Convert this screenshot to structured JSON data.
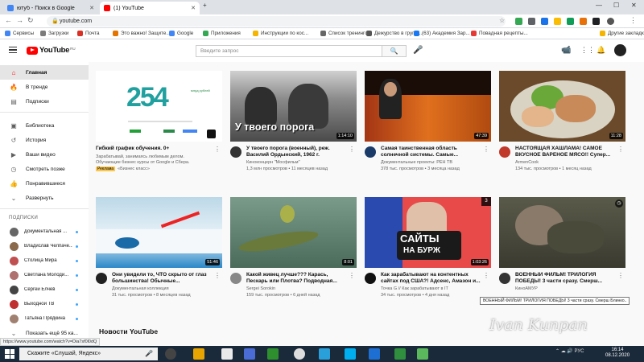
{
  "browser": {
    "tabs": [
      {
        "label": "ютуб - Поиск в Google",
        "icon_color": "#4285f4"
      },
      {
        "label": "(1) YouTube",
        "icon_color": "#ff0000"
      }
    ],
    "url": "youtube.com",
    "bookmarks": [
      {
        "label": "Сервисы",
        "color": "#4285f4"
      },
      {
        "label": "Загрузки",
        "color": "#7b7b7b"
      },
      {
        "label": "Почта",
        "color": "#d93025"
      },
      {
        "label": "Это важно! Защите...",
        "color": "#e37400"
      },
      {
        "label": "Google",
        "color": "#4285f4"
      },
      {
        "label": "Приложения",
        "color": "#34a853"
      },
      {
        "label": "Инструкции по кос...",
        "color": "#f4b400"
      },
      {
        "label": "Список тренингов",
        "color": "#666666"
      },
      {
        "label": "Дежурство в групп...",
        "color": "#555555"
      },
      {
        "label": "(63) Академия Зар...",
        "color": "#1877f2"
      },
      {
        "label": "Повадная рецепты...",
        "color": "#e53935"
      },
      {
        "label": "Другие закладки",
        "color": "#f4b400"
      }
    ]
  },
  "header": {
    "logo_text": "YouTube",
    "logo_region": "RU",
    "search_placeholder": "Введите запрос",
    "notif_count": "1"
  },
  "sidebar": {
    "items": [
      {
        "label": "Главная",
        "icon": "⌂"
      },
      {
        "label": "В тренде",
        "icon": "🔥"
      },
      {
        "label": "Подписки",
        "icon": "▤"
      },
      {
        "label": "Библиотека",
        "icon": "▣"
      },
      {
        "label": "История",
        "icon": "↺"
      },
      {
        "label": "Ваши видео",
        "icon": "▶"
      },
      {
        "label": "Смотреть позже",
        "icon": "◷"
      },
      {
        "label": "Понравившиеся",
        "icon": "👍"
      },
      {
        "label": "Развернуть",
        "icon": "⌄"
      }
    ],
    "subs_heading": "ПОДПИСКИ",
    "subs": [
      {
        "name": "Документальная ...",
        "color": "#666"
      },
      {
        "name": "Владислав Челпаче...",
        "color": "#8a6a4a"
      },
      {
        "name": "Столица Мира",
        "color": "#c05050"
      },
      {
        "name": "Светлана Молоди...",
        "color": "#b07070"
      },
      {
        "name": "Сергей Елчев",
        "color": "#444"
      },
      {
        "name": "Выходной ТВ",
        "color": "#c03030"
      },
      {
        "name": "Татьяна Прядкина",
        "color": "#a08070"
      }
    ],
    "show_more": "Показать ещё 95 ка..."
  },
  "videos": [
    {
      "title": "Гибкий график обучения. 0+",
      "channel": "Зарабатывай, занимаясь любимым делом. Обучающие бизнес курсы от Google и Сбера.",
      "meta": "«Бизнес класс»",
      "badge": "Реклама",
      "duration": "",
      "thumb_big": "254",
      "thumb_small": "млрд рублей"
    },
    {
      "title": "У твоего порога (военный), реж. Василий Ордынский, 1962 г.",
      "channel": "Киноконцерн \"Мосфильм\"",
      "meta": "1,3 млн просмотров • 11 месяцев назад",
      "duration": "1:14:10",
      "thumb_text": "У твоего порога"
    },
    {
      "title": "Самая таинственная область солнечной системы. Самые...",
      "channel": "Документальные проекты: РЕН ТВ",
      "meta": "378 тыс. просмотров • 3 месяца назад",
      "duration": "47:39"
    },
    {
      "title": "НАСТОЯЩАЯ ХАШЛАМА! САМОЕ ВКУСНОЕ ВАРЕНОЕ МЯСО!! Супер...",
      "channel": "ArmenCook",
      "meta": "134 тыс. просмотров • 1 месяц назад",
      "duration": "11:28"
    },
    {
      "title": "Они увидели то, ЧТО скрыто от глаз большинства! Обычные...",
      "channel": "Документальная коллекция",
      "meta": "31 тыс. просмотров • 8 месяцев назад",
      "duration": "51:46"
    },
    {
      "title": "Какой живец лучше??? Карась, Пескарь или Плотва? Подводная...",
      "channel": "Sergei Sorokin",
      "meta": "159 тыс. просмотров • 6 дней назад",
      "duration": "8:01"
    },
    {
      "title": "Как зарабатывают на контентных сайтах под США?! Адсенс, Амазон и...",
      "channel": "Точка G // Как зарабатывают в IT",
      "meta": "34 тыс. просмотров • 4 дня назад",
      "duration": "1:03:26",
      "thumb_l1": "САЙТЫ",
      "thumb_l2": "НА БУРЖ",
      "thumb_count": "3"
    },
    {
      "title": "ВОЕННЫЙ ФИЛЬМ! ТРИЛОГИЯ ПОБЕДЫ! 3 части сразу. Смерш...",
      "channel": "КиноАМУР",
      "meta": "",
      "duration": ""
    }
  ],
  "news_heading": "Новости YouTube",
  "tooltip": "ВОЕННЫЙ ФИЛЬМ! ТРИЛОГИЯ ПОБЕДЫ! 3 части сразу. Смерш Блинко..",
  "status_url": "https://www.youtube.com/watch?v=Dia7sf0l0dQ",
  "watermark": "Ivan Kunpan",
  "taskbar": {
    "search_text": "Скажите «Слушай, Яндекс»",
    "time": "16:14",
    "date": "08.12.2020",
    "lang": "РУС"
  }
}
